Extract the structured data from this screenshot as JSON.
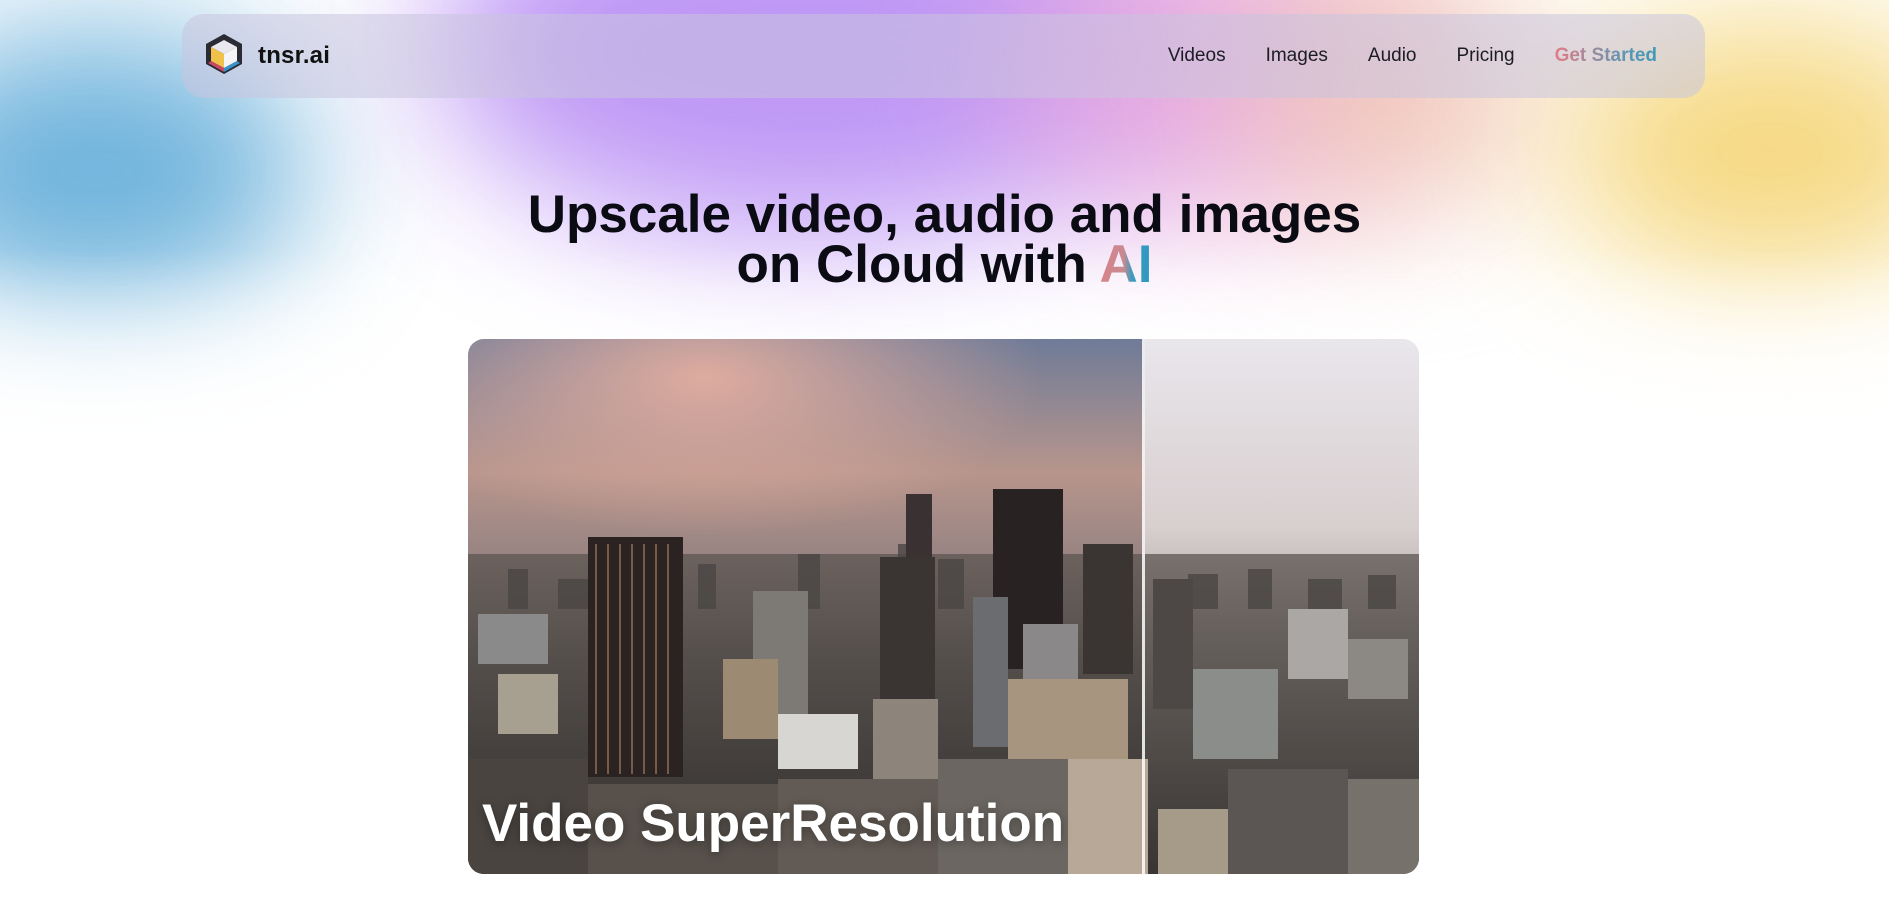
{
  "brand": {
    "name": "tnsr.ai",
    "logo_icon": "cube-logo-icon"
  },
  "nav": {
    "links": [
      "Videos",
      "Images",
      "Audio",
      "Pricing"
    ],
    "cta": "Get Started",
    "cta_colors": [
      "#e37c86",
      "#3e9ab8"
    ]
  },
  "hero": {
    "line1": "Upscale video, audio and images",
    "line2_prefix": "on Cloud with ",
    "line2_highlight": "AI"
  },
  "video": {
    "caption": "Video SuperResolution",
    "comparison_split": 0.71
  },
  "colors": {
    "background": "#ffffff",
    "nav_bg": "rgba(200,196,222,0.55)",
    "text": "#0b0b14"
  }
}
